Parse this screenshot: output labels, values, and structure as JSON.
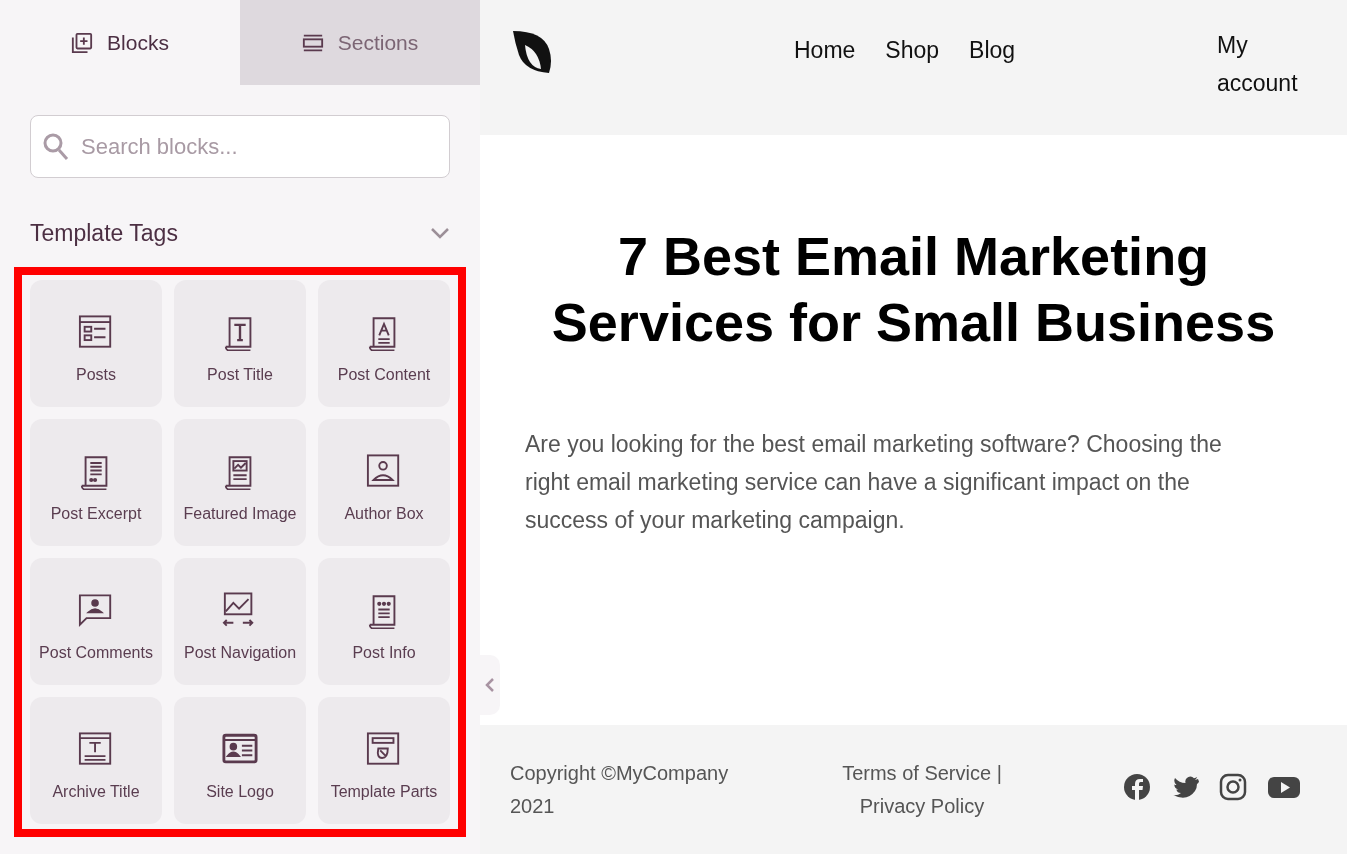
{
  "sidebar": {
    "tabs": [
      {
        "label": "Blocks",
        "kind": "blocks",
        "selected": true
      },
      {
        "label": "Sections",
        "kind": "sections",
        "selected": false
      }
    ],
    "search": {
      "placeholder": "Search blocks..."
    },
    "group": {
      "title": "Template Tags",
      "expanded": true,
      "highlighted": true,
      "items": [
        {
          "label": "Posts",
          "kind": "posts"
        },
        {
          "label": "Post Title",
          "kind": "title"
        },
        {
          "label": "Post Content",
          "kind": "content"
        },
        {
          "label": "Post Excerpt",
          "kind": "excerpt"
        },
        {
          "label": "Featured Image",
          "kind": "image"
        },
        {
          "label": "Author Box",
          "kind": "author"
        },
        {
          "label": "Post Comments",
          "kind": "comments"
        },
        {
          "label": "Post Navigation",
          "kind": "navigation"
        },
        {
          "label": "Post Info",
          "kind": "info"
        },
        {
          "label": "Archive Title",
          "kind": "archive"
        },
        {
          "label": "Site Logo",
          "kind": "logo"
        },
        {
          "label": "Template Parts",
          "kind": "parts"
        }
      ]
    }
  },
  "header": {
    "nav": [
      "Home",
      "Shop",
      "Blog"
    ],
    "account": "My account"
  },
  "article": {
    "title": "7 Best Email Marketing Services for Small Business",
    "body": "Are you looking for the best email marketing software? Choosing the right email marketing service can have a significant impact on the success of your marketing campaign."
  },
  "footer": {
    "copyright": "Copyright ©MyCompany 2021",
    "links": [
      "Terms of Service",
      "|",
      "Privacy Policy"
    ],
    "social": [
      {
        "kind": "facebook"
      },
      {
        "kind": "twitter"
      },
      {
        "kind": "instagram"
      },
      {
        "kind": "youtube"
      }
    ]
  }
}
